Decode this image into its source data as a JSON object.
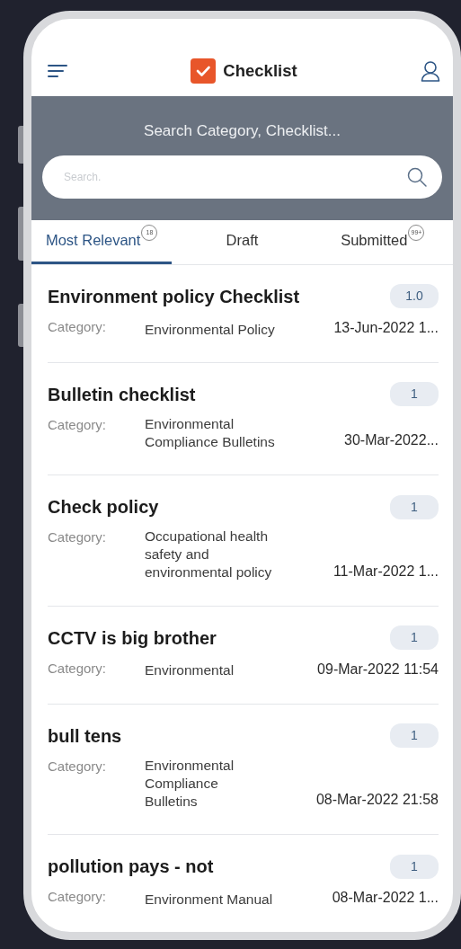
{
  "header": {
    "title": "Checklist"
  },
  "search": {
    "label": "Search Category, Checklist...",
    "placeholder": "Search."
  },
  "tabs": [
    {
      "label": "Most Relevant",
      "count": "18",
      "selected": true
    },
    {
      "label": "Draft",
      "selected": false
    },
    {
      "label": "Submitted",
      "count": "99+",
      "selected": false
    }
  ],
  "items": [
    {
      "title": "Environment policy Checklist",
      "version": "1.0",
      "category_label": "Category:",
      "category_lines": [
        "Environmental Policy"
      ],
      "date": "13-Jun-2022 1..."
    },
    {
      "title": "Bulletin checklist",
      "version": "1",
      "category_label": "Category:",
      "category_lines": [
        "Environmental",
        "Compliance Bulletins"
      ],
      "date": "30-Mar-2022..."
    },
    {
      "title": "Check policy",
      "version": "1",
      "category_label": "Category:",
      "category_lines": [
        "Occupational health",
        "safety and",
        "environmental policy"
      ],
      "date": "11-Mar-2022 1..."
    },
    {
      "title": "CCTV is big brother",
      "version": "1",
      "category_label": "Category:",
      "category_lines": [
        "Environmental"
      ],
      "date": "09-Mar-2022 11:54"
    },
    {
      "title": "bull tens",
      "version": "1",
      "category_label": "Category:",
      "category_lines": [
        "Environmental",
        "Compliance",
        "Bulletins"
      ],
      "date": "08-Mar-2022 21:58"
    },
    {
      "title": "pollution pays - not",
      "version": "1",
      "category_label": "Category:",
      "category_lines": [
        "Environment Manual"
      ],
      "date": "08-Mar-2022 1..."
    }
  ]
}
